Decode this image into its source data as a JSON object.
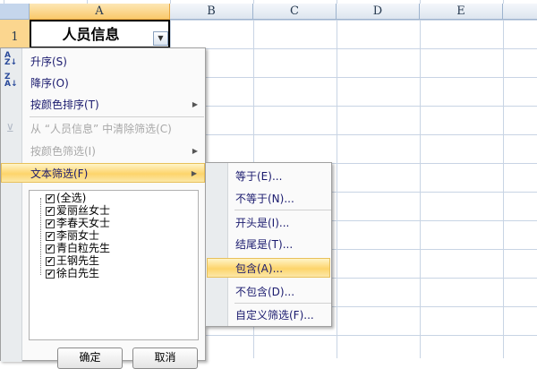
{
  "columns": [
    "A",
    "B",
    "C",
    "D",
    "E"
  ],
  "row_number": "1",
  "cell_a1": "人员信息",
  "menu": {
    "sort_asc": "升序(S)",
    "sort_desc": "降序(O)",
    "sort_by_color": "按颜色排序(T)",
    "clear_filter": "从 “人员信息” 中清除筛选(C)",
    "filter_by_color": "按颜色筛选(I)",
    "text_filter": "文本筛选(F)"
  },
  "list": [
    "(全选)",
    "爱丽丝女士",
    "李春天女士",
    "李丽女士",
    "青白粒先生",
    "王钢先生",
    "徐白先生"
  ],
  "buttons": {
    "ok": "确定",
    "cancel": "取消"
  },
  "submenu": [
    "等于(E)...",
    "不等于(N)...",
    "开头是(I)...",
    "结尾是(T)...",
    "包含(A)...",
    "不包含(D)...",
    "自定义筛选(F)..."
  ]
}
